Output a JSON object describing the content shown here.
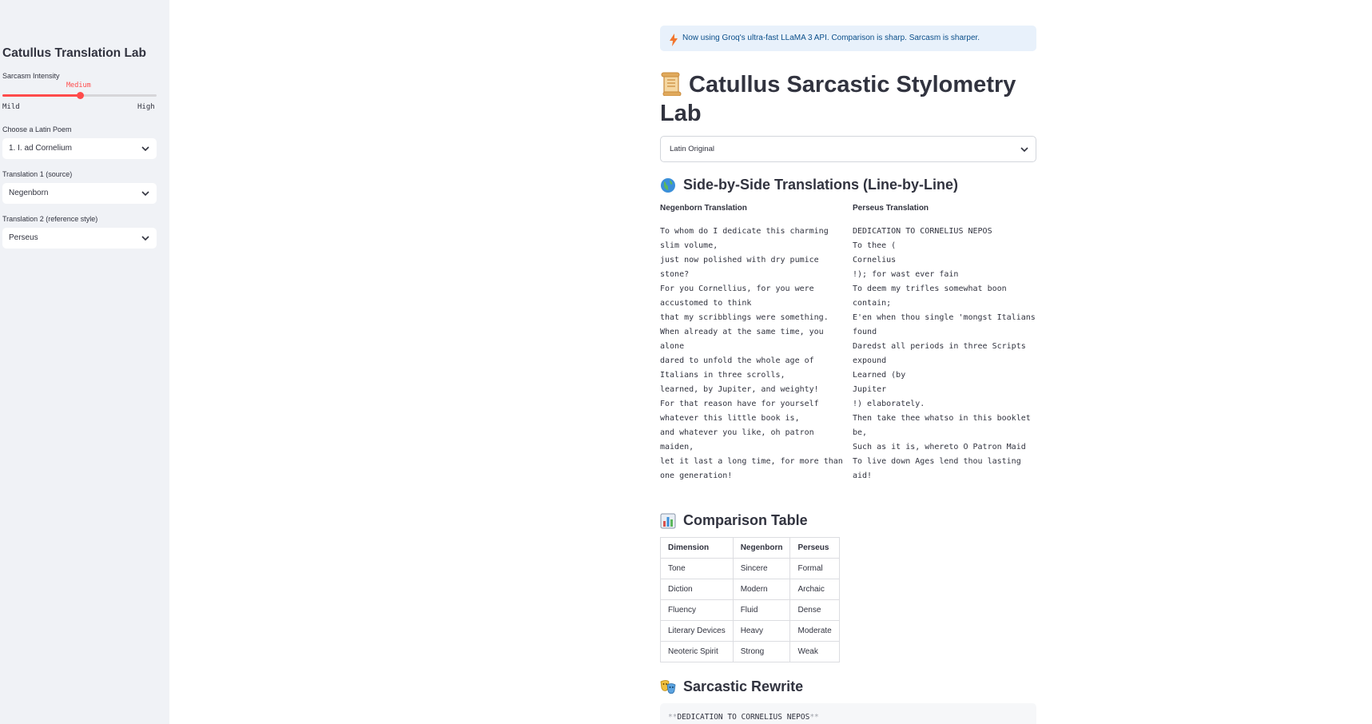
{
  "sidebar": {
    "title": "Catullus Translation Lab",
    "sarcasm": {
      "label": "Sarcasm Intensity",
      "value": "Medium",
      "min": "Mild",
      "max": "High",
      "level": 0.5
    },
    "poem": {
      "label": "Choose a Latin Poem",
      "selected": "1. I. ad Cornelium"
    },
    "translation1": {
      "label": "Translation 1 (source)",
      "selected": "Negenborn"
    },
    "translation2": {
      "label": "Translation 2 (reference style)",
      "selected": "Perseus"
    }
  },
  "banner": {
    "text": "Now using Groq's ultra-fast LLaMA 3 API. Comparison is sharp. Sarcasm is sharper.",
    "icon": "lightning-icon"
  },
  "page_title": "Catullus Sarcastic Stylometry Lab",
  "view_select": {
    "selected": "Latin Original"
  },
  "side_by_side": {
    "heading": "Side-by-Side Translations (Line-by-Line)",
    "left": {
      "header": "Negenborn Translation",
      "lines": "To whom do I dedicate this charming\nslim volume,\njust now polished with dry pumice\nstone?\nFor you Cornellius, for you were\naccustomed to think\nthat my scribblings were something.\nWhen already at the same time, you\nalone\ndared to unfold the whole age of\nItalians in three scrolls,\nlearned, by Jupiter, and weighty!\nFor that reason have for yourself\nwhatever this little book is,\nand whatever you like, oh patron\nmaiden,\nlet it last a long time, for more than\none generation!"
    },
    "right": {
      "header": "Perseus Translation",
      "lines": "DEDICATION TO CORNELIUS NEPOS\nTo thee (\nCornelius\n!); for wast ever fain\nTo deem my trifles somewhat boon\ncontain;\nE'en when thou single 'mongst Italians\nfound\nDaredst all periods in three Scripts\nexpound\nLearned (by\nJupiter\n!) elaborately.\nThen take thee whatso in this booklet\nbe,\nSuch as it is, whereto O Patron Maid\nTo live down Ages lend thou lasting\naid!"
    }
  },
  "comparison": {
    "heading": "Comparison Table",
    "columns": [
      "Dimension",
      "Negenborn",
      "Perseus"
    ],
    "rows": [
      [
        "Tone",
        "Sincere",
        "Formal"
      ],
      [
        "Diction",
        "Modern",
        "Archaic"
      ],
      [
        "Fluency",
        "Fluid",
        "Dense"
      ],
      [
        "Literary Devices",
        "Heavy",
        "Moderate"
      ],
      [
        "Neoteric Spirit",
        "Strong",
        "Weak"
      ]
    ]
  },
  "rewrite": {
    "heading": "Sarcastic Rewrite",
    "stars": "**",
    "text": "DEDICATION TO CORNELIUS NEPOS"
  }
}
